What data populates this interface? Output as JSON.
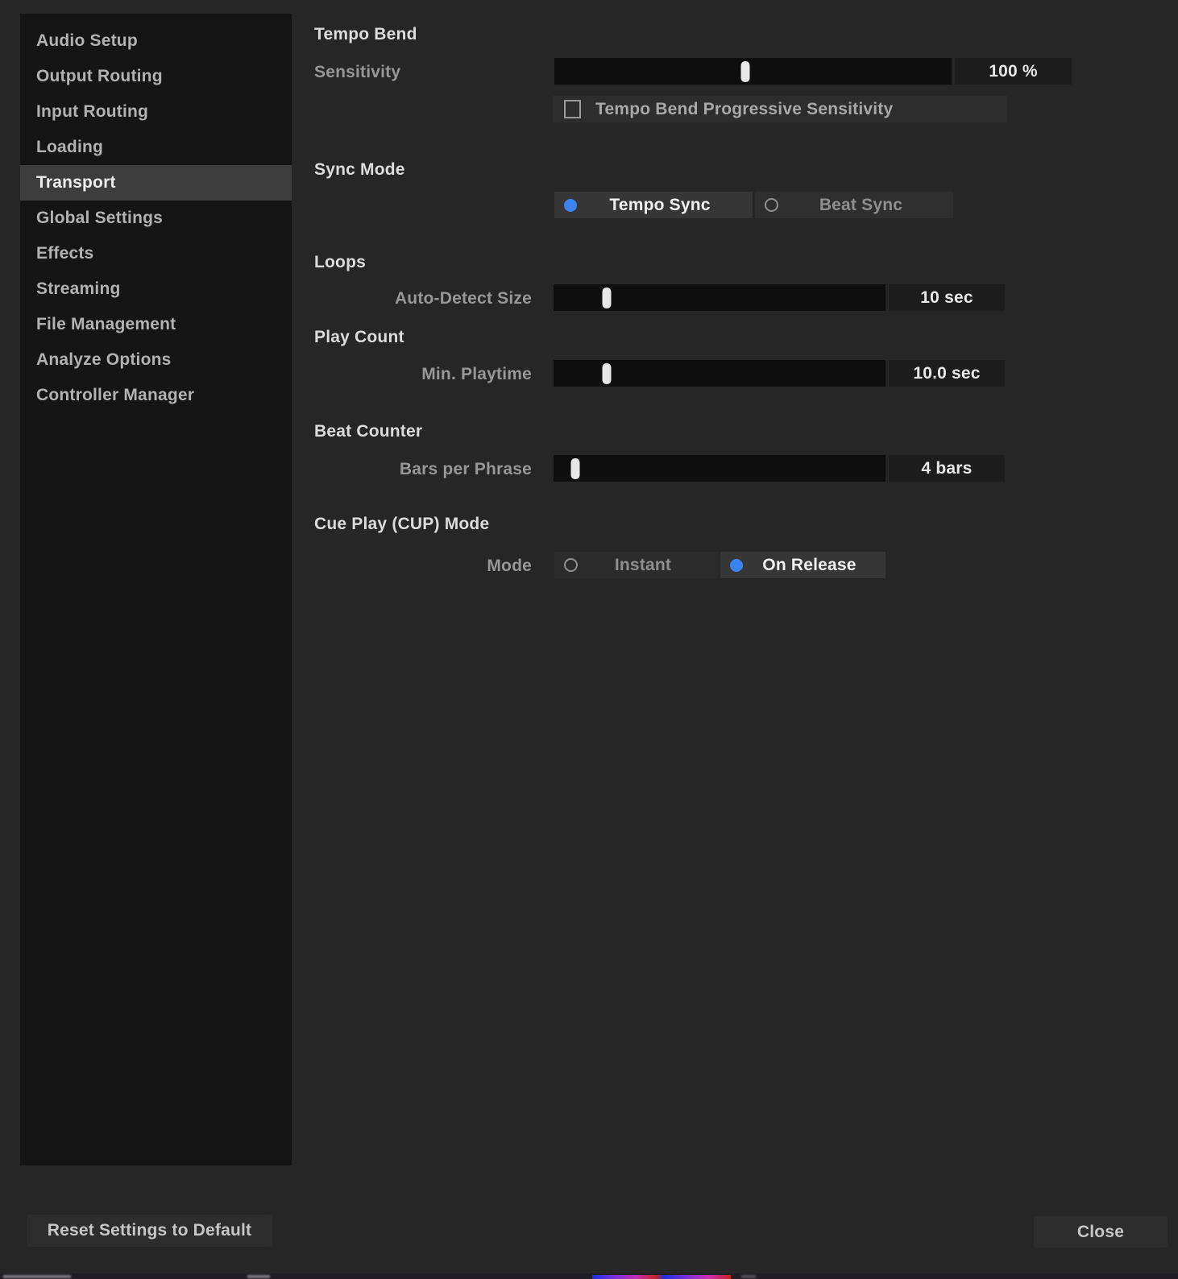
{
  "colors": {
    "accent_blue": "#3c83f0",
    "panel_bg": "#262626",
    "sidebar_bg": "#151515"
  },
  "sidebar": {
    "items": [
      {
        "label": "Audio Setup",
        "selected": false
      },
      {
        "label": "Output Routing",
        "selected": false
      },
      {
        "label": "Input Routing",
        "selected": false
      },
      {
        "label": "Loading",
        "selected": false
      },
      {
        "label": "Transport",
        "selected": true
      },
      {
        "label": "Global Settings",
        "selected": false
      },
      {
        "label": "Effects",
        "selected": false
      },
      {
        "label": "Streaming",
        "selected": false
      },
      {
        "label": "File Management",
        "selected": false
      },
      {
        "label": "Analyze Options",
        "selected": false
      },
      {
        "label": "Controller Manager",
        "selected": false
      }
    ]
  },
  "transport": {
    "tempo_bend": {
      "title": "Tempo Bend",
      "sensitivity": {
        "label": "Sensitivity",
        "value": "100 %",
        "handle_pct": 48
      },
      "progressive": {
        "label": "Tempo Bend Progressive Sensitivity",
        "checked": false
      }
    },
    "sync_mode": {
      "title": "Sync Mode",
      "options": [
        {
          "label": "Tempo Sync",
          "selected": true
        },
        {
          "label": "Beat Sync",
          "selected": false
        }
      ]
    },
    "loops": {
      "title": "Loops",
      "auto_detect": {
        "label": "Auto-Detect Size",
        "value": "10 sec",
        "handle_pct": 16
      }
    },
    "play_count": {
      "title": "Play Count",
      "min_playtime": {
        "label": "Min. Playtime",
        "value": "10.0 sec",
        "handle_pct": 16
      }
    },
    "beat_counter": {
      "title": "Beat Counter",
      "bars_per_phrase": {
        "label": "Bars per Phrase",
        "value": "4 bars",
        "handle_pct": 6.5
      }
    },
    "cue_play": {
      "title": "Cue Play (CUP) Mode",
      "mode_label": "Mode",
      "options": [
        {
          "label": "Instant",
          "selected": false
        },
        {
          "label": "On Release",
          "selected": true
        }
      ]
    }
  },
  "footer": {
    "reset_label": "Reset Settings to Default",
    "close_label": "Close"
  }
}
